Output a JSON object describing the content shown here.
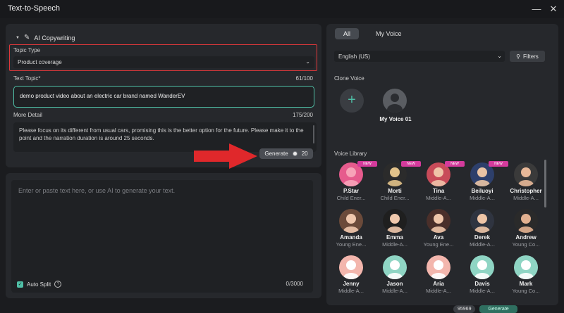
{
  "window": {
    "title": "Text-to-Speech",
    "minimize": "—",
    "close": "✕"
  },
  "copywriting": {
    "section_title": "AI Copywriting",
    "topic_type_label": "Topic Type",
    "topic_type_value": "Product coverage",
    "text_topic_label": "Text Topic*",
    "text_topic_count": "61/100",
    "text_topic_value": "demo product video about an electric car brand named WanderEV",
    "more_detail_label": "More Detail",
    "more_detail_count": "175/200",
    "more_detail_value": "Please focus on its different from usual cars, promising this is the better option for the future. Please make it to the point and the narration duration is around 25 seconds.",
    "generate_label": "Generate",
    "generate_cost": "20"
  },
  "editor": {
    "placeholder": "Enter or paste text here, or use AI to generate your text.",
    "auto_split_label": "Auto Split",
    "char_count": "0/3000"
  },
  "voice_panel": {
    "tabs": [
      {
        "label": "All",
        "active": true
      },
      {
        "label": "My Voice",
        "active": false
      }
    ],
    "language": "English (US)",
    "filters_label": "Filters",
    "clone_voice_label": "Clone Voice",
    "my_voice_name": "My Voice 01",
    "library_label": "Voice Library",
    "new_badge": "NEW",
    "voices": [
      {
        "name": "P.Star",
        "desc": "Child Ener...",
        "new": true,
        "color": "#e65b8d",
        "skin": "#f7a3b8"
      },
      {
        "name": "Morti",
        "desc": "Child Ener...",
        "new": true,
        "color": "#2b2b2b",
        "skin": "#e2c28a"
      },
      {
        "name": "Tina",
        "desc": "Middle-A...",
        "new": true,
        "color": "#c84b59",
        "skin": "#efc3a8"
      },
      {
        "name": "Beiluoyi",
        "desc": "Middle-A...",
        "new": true,
        "color": "#2d3f6b",
        "skin": "#e9c3a4"
      },
      {
        "name": "Christopher",
        "desc": "Middle-A...",
        "new": false,
        "color": "#3a3a3a",
        "skin": "#e8b898"
      },
      {
        "name": "Amanda",
        "desc": "Young Ene...",
        "new": false,
        "color": "#6b4a3a",
        "skin": "#efc7ad"
      },
      {
        "name": "Emma",
        "desc": "Middle-A...",
        "new": false,
        "color": "#1f1f1f",
        "skin": "#f0c8ac"
      },
      {
        "name": "Ava",
        "desc": "Young Ene...",
        "new": false,
        "color": "#4a2f2a",
        "skin": "#efc6aa"
      },
      {
        "name": "Derek",
        "desc": "Middle-A...",
        "new": false,
        "color": "#2f3440",
        "skin": "#eec5a7"
      },
      {
        "name": "Andrew",
        "desc": "Young Co...",
        "new": false,
        "color": "#2a2a2a",
        "skin": "#e3b190"
      },
      {
        "name": "Jenny",
        "desc": "Middle-A...",
        "new": false,
        "color": "#f3b6ad",
        "skin": "#ffffff"
      },
      {
        "name": "Jason",
        "desc": "Middle-A...",
        "new": false,
        "color": "#8fd5c4",
        "skin": "#ffffff"
      },
      {
        "name": "Aria",
        "desc": "Middle-A...",
        "new": false,
        "color": "#f3b6ad",
        "skin": "#ffffff"
      },
      {
        "name": "Davis",
        "desc": "Middle-A...",
        "new": false,
        "color": "#8fd5c4",
        "skin": "#ffffff"
      },
      {
        "name": "Mark",
        "desc": "Young Co...",
        "new": false,
        "color": "#8fd5c4",
        "skin": "#ffffff"
      }
    ]
  },
  "bottom": {
    "credits": "95969",
    "generate_label": "Generate"
  }
}
